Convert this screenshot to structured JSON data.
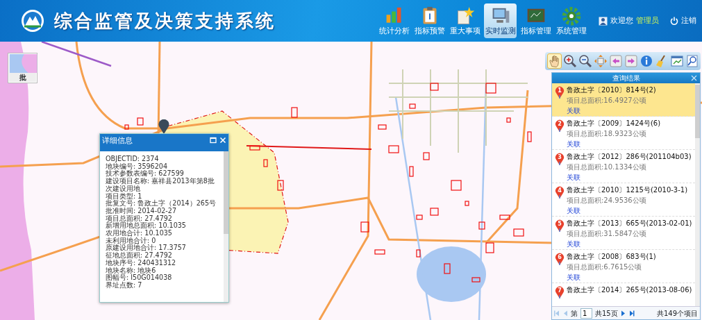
{
  "header": {
    "title": "综合监管及决策支持系统",
    "welcome": "欢迎您",
    "user": "管理员",
    "logout": "注销"
  },
  "nav": [
    {
      "label": "统计分析",
      "kind": "chart",
      "selected": false
    },
    {
      "label": "指标预警",
      "kind": "clipboard",
      "selected": false
    },
    {
      "label": "重大事项",
      "kind": "star",
      "selected": false
    },
    {
      "label": "实时监测",
      "kind": "monitor",
      "selected": true
    },
    {
      "label": "指标管理",
      "kind": "board",
      "selected": false
    },
    {
      "label": "系统管理",
      "kind": "gear",
      "selected": false
    }
  ],
  "basemap_switch": {
    "label": "批"
  },
  "tools": [
    {
      "kind": "pan",
      "selected": true
    },
    {
      "kind": "zoom-in",
      "selected": false
    },
    {
      "kind": "zoom-out",
      "selected": false
    },
    {
      "kind": "extent",
      "selected": false
    },
    {
      "kind": "previous",
      "selected": false
    },
    {
      "kind": "next",
      "selected": false
    },
    {
      "kind": "info",
      "selected": false
    },
    {
      "kind": "clear",
      "selected": false
    },
    {
      "kind": "edit",
      "selected": false
    },
    {
      "kind": "find",
      "selected": false
    }
  ],
  "detail_popup": {
    "title": "详细信息",
    "lines": [
      "OBJECTID: 2374",
      "地块编号: 3596204",
      "技术参数表编号: 627599",
      "建设项目名称: 嘉祥县2013年第8批次建设用地",
      "项目类型: 1",
      "批复文号: 鲁政土字（2014）265号",
      "批准时间: 2014-02-27",
      "项目总面积: 27.4792",
      "新增用地总面积: 10.1035",
      "农用地合计: 10.1035",
      "未利用地合计: 0",
      "原建设用地合计: 17.3757",
      "征地总面积: 27.4792",
      "地块序号: 240431312",
      "地块名称: 地块6",
      "图幅号: I50G014038",
      "界址点数: 7"
    ]
  },
  "results": {
    "title": "查询结果",
    "items": [
      {
        "number": "1",
        "title": "鲁政土字〔2010〕814号(2)",
        "area": "项目总面积:16.4927公顷",
        "link": "关联",
        "selected": true
      },
      {
        "number": "2",
        "title": "鲁政土字〔2009〕1424号(6)",
        "area": "项目总面积:18.9323公顷",
        "link": "关联",
        "selected": false
      },
      {
        "number": "3",
        "title": "鲁政土字〔2012〕286号(201104b03)",
        "area": "项目总面积:10.1334公顷",
        "link": "关联",
        "selected": false
      },
      {
        "number": "4",
        "title": "鲁政土字〔2010〕1215号(2010-3-1)",
        "area": "项目总面积:24.9536公顷",
        "link": "关联",
        "selected": false
      },
      {
        "number": "5",
        "title": "鲁政土字〔2013〕665号(2013-02-01)",
        "area": "项目总面积:31.5847公顷",
        "link": "关联",
        "selected": false
      },
      {
        "number": "6",
        "title": "鲁政土字〔2008〕683号(1)",
        "area": "项目总面积:6.7615公顷",
        "link": "关联",
        "selected": false
      },
      {
        "number": "7",
        "title": "鲁政土字〔2014〕265号(2013-08-06)",
        "selected": false
      }
    ],
    "pager": {
      "page_prefix": "第",
      "page": "1",
      "pages": "共15页",
      "total": "共149个项目"
    }
  }
}
